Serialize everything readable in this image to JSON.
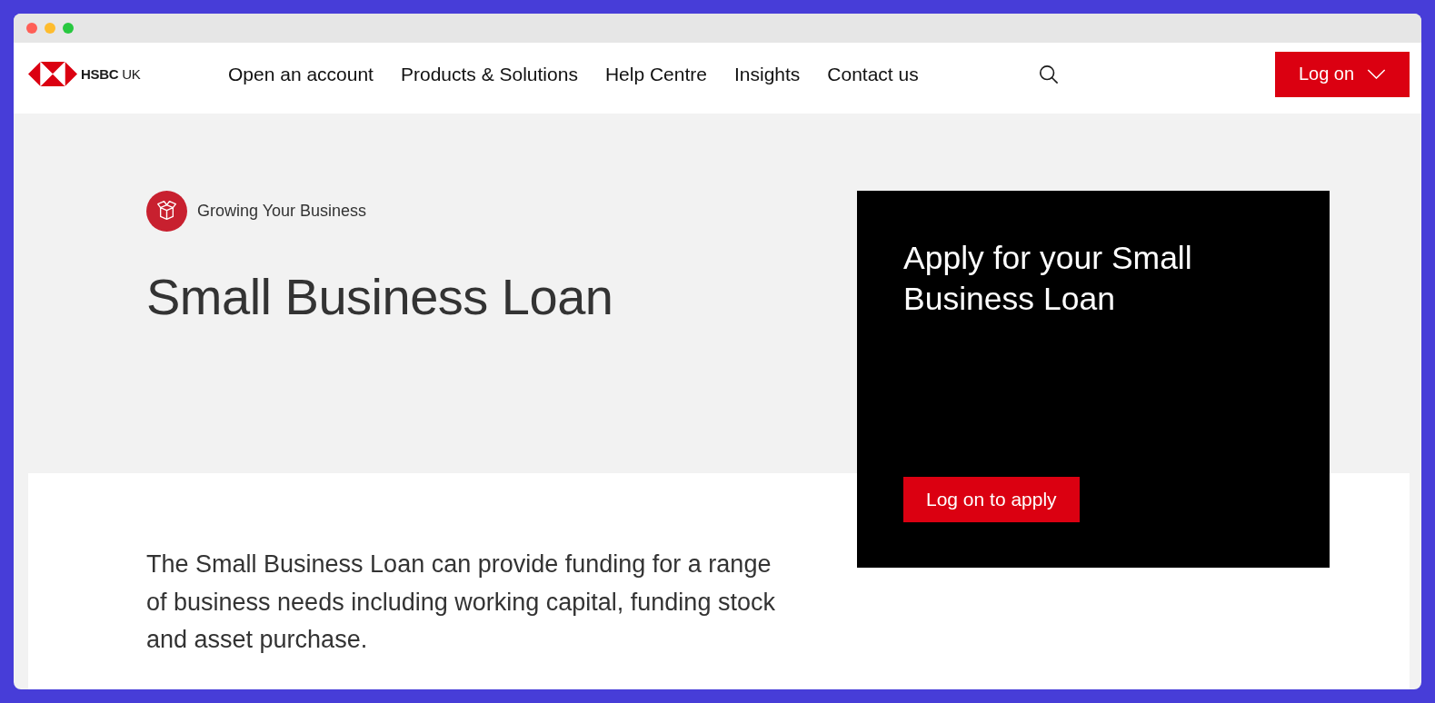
{
  "header": {
    "logo": {
      "brand": "HSBC",
      "region": "UK"
    },
    "nav": [
      {
        "label": "Open an account"
      },
      {
        "label": "Products & Solutions"
      },
      {
        "label": "Help Centre"
      },
      {
        "label": "Insights"
      },
      {
        "label": "Contact us"
      }
    ],
    "login_button": {
      "label": "Log on"
    }
  },
  "hero": {
    "category": "Growing Your Business",
    "title": "Small Business Loan"
  },
  "apply_card": {
    "title": "Apply for your Small Business Loan",
    "button": "Log on to apply"
  },
  "intro": {
    "text": "The Small Business Loan can provide funding for a range of business needs including working capital, funding stock and asset purchase."
  }
}
